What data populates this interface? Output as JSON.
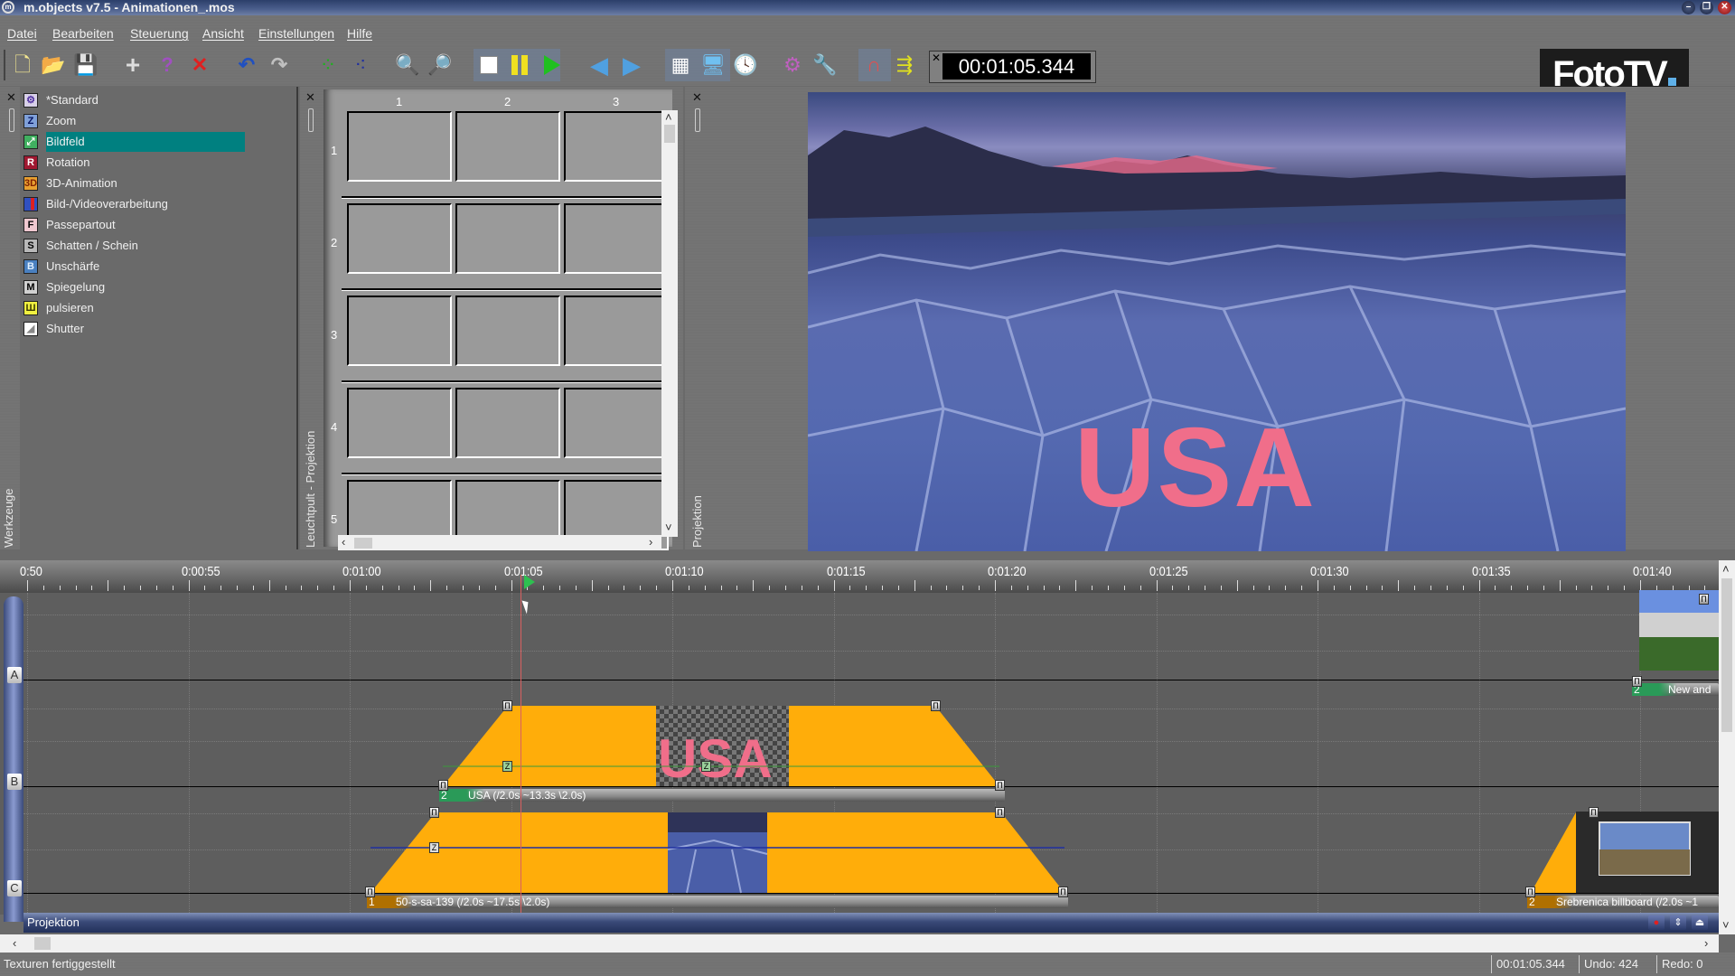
{
  "window": {
    "title": "m.objects v7.5 - Animationen_.mos",
    "controls": [
      "minimize",
      "restore",
      "close"
    ]
  },
  "menu": [
    "Datei",
    "Bearbeiten",
    "Steuerung",
    "Ansicht",
    "Einstellungen",
    "Hilfe"
  ],
  "toolbar": {
    "buttons": [
      {
        "name": "new-file",
        "icon": "new-file-icon"
      },
      {
        "name": "open-folder",
        "icon": "open-folder-icon"
      },
      {
        "name": "save",
        "icon": "floppy-disk-icon"
      },
      {
        "name": "add",
        "icon": "plus-icon"
      },
      {
        "name": "help",
        "icon": "question-mark-icon"
      },
      {
        "name": "delete",
        "icon": "red-x-icon"
      },
      {
        "name": "undo",
        "icon": "undo-arrow-icon"
      },
      {
        "name": "redo",
        "icon": "redo-arrow-icon"
      },
      {
        "name": "group",
        "icon": "green-dots-icon"
      },
      {
        "name": "ungroup",
        "icon": "blue-dots-icon"
      },
      {
        "name": "zoom-in",
        "icon": "magnifier-plus-icon"
      },
      {
        "name": "zoom-out",
        "icon": "magnifier-minus-icon"
      },
      {
        "name": "stop",
        "icon": "stop-icon"
      },
      {
        "name": "pause",
        "icon": "pause-icon"
      },
      {
        "name": "play",
        "icon": "play-icon"
      },
      {
        "name": "previous",
        "icon": "arrow-left-icon"
      },
      {
        "name": "next",
        "icon": "arrow-right-icon"
      },
      {
        "name": "light-table",
        "icon": "grid-table-icon"
      },
      {
        "name": "projection-view",
        "icon": "monitor-icon"
      },
      {
        "name": "clock",
        "icon": "clock-icon"
      },
      {
        "name": "settings",
        "icon": "gears-icon"
      },
      {
        "name": "tools",
        "icon": "wrench-icon"
      },
      {
        "name": "magnet",
        "icon": "magnet-icon"
      },
      {
        "name": "export",
        "icon": "export-arrows-icon"
      }
    ],
    "timecode": "00:01:05.344"
  },
  "logo": {
    "text": "FotoTV",
    "accent": "#5fb0e8"
  },
  "tools_panel": {
    "vertical_label": "Werkzeuge",
    "items": [
      {
        "label": "*Standard",
        "icon_char": "⚙",
        "icon_bg": "#d8d0e8",
        "icon_fg": "#5030a0",
        "selected": false
      },
      {
        "label": "Zoom",
        "icon_char": "Z",
        "icon_bg": "#7fa0d8",
        "icon_fg": "#001060",
        "selected": false
      },
      {
        "label": "Bildfeld",
        "icon_char": "⤢",
        "icon_bg": "#40b060",
        "icon_fg": "#ffffff",
        "selected": true
      },
      {
        "label": "Rotation",
        "icon_char": "R",
        "icon_bg": "#a01830",
        "icon_fg": "#ffffff",
        "selected": false
      },
      {
        "label": "3D-Animation",
        "icon_char": "3D",
        "icon_bg": "#e8a030",
        "icon_fg": "#802000",
        "selected": false
      },
      {
        "label": "Bild-/Videoverarbeitung",
        "icon_char": "▐",
        "icon_bg": "#3050c0",
        "icon_fg": "#e02020",
        "selected": false
      },
      {
        "label": "Passepartout",
        "icon_char": "F",
        "icon_bg": "#f0c8d0",
        "icon_fg": "#000000",
        "selected": false
      },
      {
        "label": "Schatten / Schein",
        "icon_char": "S",
        "icon_bg": "#b8b8b8",
        "icon_fg": "#000000",
        "selected": false
      },
      {
        "label": "Unschärfe",
        "icon_char": "B",
        "icon_bg": "#4a80c0",
        "icon_fg": "#e0f0ff",
        "selected": false
      },
      {
        "label": "Spiegelung",
        "icon_char": "M",
        "icon_bg": "#d0d0d0",
        "icon_fg": "#000000",
        "selected": false
      },
      {
        "label": "pulsieren",
        "icon_char": "Ш",
        "icon_bg": "#f0f040",
        "icon_fg": "#3a3a00",
        "selected": false
      },
      {
        "label": "Shutter",
        "icon_char": "◢",
        "icon_bg": "#ffffff",
        "icon_fg": "#888888",
        "selected": false
      }
    ],
    "selected_color": "#008080"
  },
  "light_table": {
    "vertical_label": "Leuchtpult - Projektion",
    "columns": [
      "1",
      "2",
      "3"
    ],
    "rows": [
      "1",
      "2",
      "3",
      "4",
      "5"
    ]
  },
  "projection": {
    "vertical_label": "Projektion",
    "overlay_text": "USA",
    "overlay_color": "#f06e8a"
  },
  "timeline": {
    "ruler_labels": [
      "0:50",
      "0:00:55",
      "0:01:00",
      "0:01:05",
      "0:01:10",
      "0:01:15",
      "0:01:20",
      "0:01:25",
      "0:01:30",
      "0:01:35",
      "0:01:40"
    ],
    "playhead": "0:01:05.344",
    "tracks": [
      "A",
      "B",
      "C"
    ],
    "clips": [
      {
        "track": "B",
        "number": "2",
        "label": "USA (/2.0s ~13.3s \\2.0s)",
        "tag_color": "#2a9a58",
        "thumb_text": "USA"
      },
      {
        "track": "C",
        "number": "1",
        "label": "50-s-sa-139 (/2.0s ~17.5s \\2.0s)",
        "tag_color": "#b07000"
      },
      {
        "track": "A",
        "number": "2",
        "label": "New and",
        "tag_color": "#2a9a58"
      },
      {
        "track": "C",
        "number": "2",
        "label": "Srebrenica billboard (/2.0s ~1",
        "tag_color": "#b07000"
      }
    ],
    "handle_glyph": "Π",
    "keyframe_z": "Z",
    "fill_color": "#ffad0a",
    "bottom_bar_label": "Projektion"
  },
  "status": {
    "message": "Texturen fertiggestellt",
    "time": "00:01:05.344",
    "undo": "Undo: 424",
    "redo": "Redo: 0"
  }
}
